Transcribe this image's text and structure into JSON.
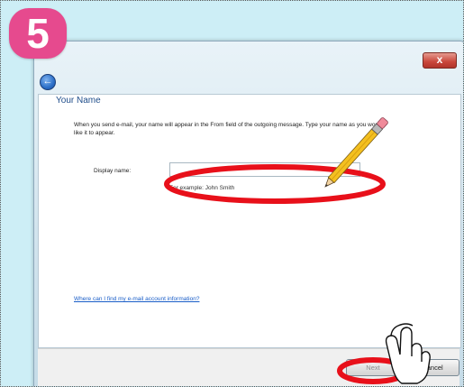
{
  "step": {
    "number": "5"
  },
  "window": {
    "close_glyph": "x",
    "back_glyph": "←"
  },
  "page": {
    "title": "Your Name",
    "instructions": "When you send e-mail, your name will appear in the From field of the outgoing message. Type your name as you would like it to appear."
  },
  "display_name": {
    "label": "Display name:",
    "value": "",
    "example": "For example: John Smith"
  },
  "help": {
    "link_text": "Where can I find my e-mail account information?"
  },
  "buttons": {
    "next_label": "Next",
    "cancel_label": "Cancel"
  },
  "colors": {
    "badge": "#e64a8e",
    "annotation_ellipse": "#e8101a",
    "link": "#1a5ec8",
    "heading": "#1f4d8a",
    "background": "#cdeef6"
  },
  "icons": [
    "pencil-icon",
    "pointing-hand-icon",
    "close-icon",
    "back-arrow-icon"
  ]
}
